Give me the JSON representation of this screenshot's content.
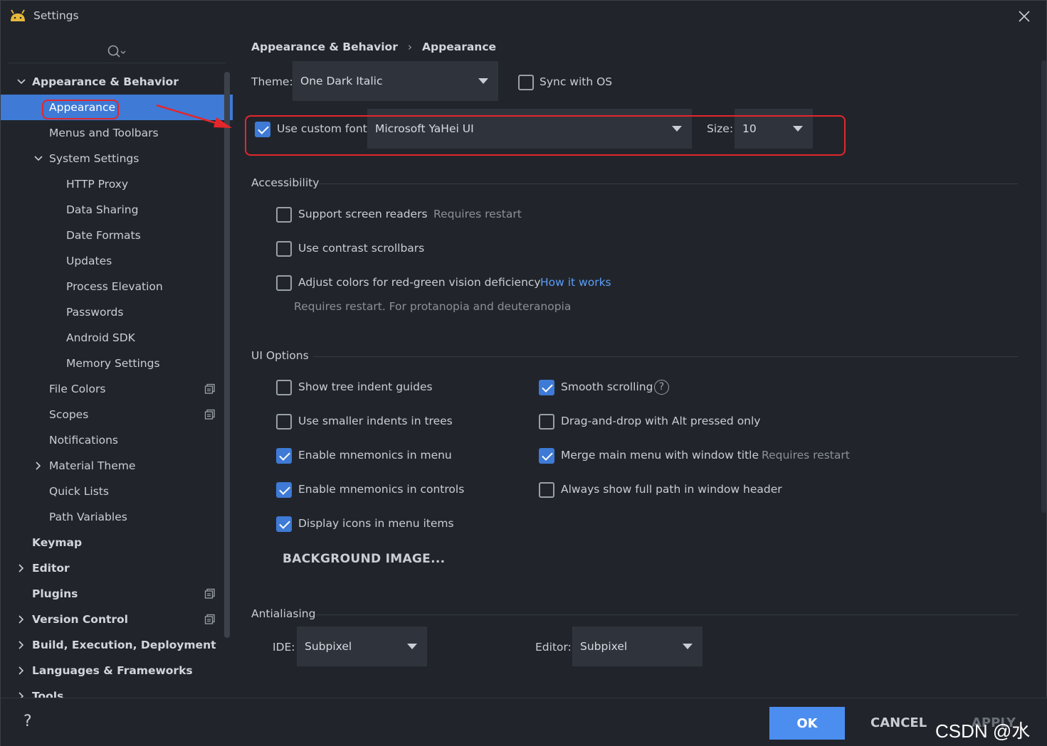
{
  "window": {
    "title": "Settings"
  },
  "colors": {
    "accent": "#3e7ad6",
    "highlight": "#e5262b",
    "link": "#5b9ef7",
    "ok_button": "#4c8ef0"
  },
  "sidebar": {
    "search_icon": "search-icon",
    "items": [
      {
        "label": "Appearance & Behavior",
        "bold": true,
        "chevron": "down"
      },
      {
        "label": "Appearance",
        "selected": true
      },
      {
        "label": "Menus and Toolbars"
      },
      {
        "label": "System Settings",
        "chevron": "down"
      },
      {
        "label": "HTTP Proxy"
      },
      {
        "label": "Data Sharing"
      },
      {
        "label": "Date Formats"
      },
      {
        "label": "Updates"
      },
      {
        "label": "Process Elevation"
      },
      {
        "label": "Passwords"
      },
      {
        "label": "Android SDK"
      },
      {
        "label": "Memory Settings"
      },
      {
        "label": "File Colors",
        "project_icon": true
      },
      {
        "label": "Scopes",
        "project_icon": true
      },
      {
        "label": "Notifications"
      },
      {
        "label": "Material Theme",
        "chevron": "right"
      },
      {
        "label": "Quick Lists"
      },
      {
        "label": "Path Variables"
      },
      {
        "label": "Keymap",
        "bold": true
      },
      {
        "label": "Editor",
        "bold": true,
        "chevron": "right"
      },
      {
        "label": "Plugins",
        "bold": true,
        "project_icon": true
      },
      {
        "label": "Version Control",
        "bold": true,
        "chevron": "right",
        "project_icon": true
      },
      {
        "label": "Build, Execution, Deployment",
        "bold": true,
        "chevron": "right"
      },
      {
        "label": "Languages & Frameworks",
        "bold": true,
        "chevron": "right"
      },
      {
        "label": "Tools",
        "bold": true,
        "chevron": "right"
      }
    ]
  },
  "breadcrumb": {
    "parent": "Appearance & Behavior",
    "separator": "›",
    "current": "Appearance"
  },
  "theme": {
    "label": "Theme:",
    "value": "One Dark Italic",
    "sync_label": "Sync with OS",
    "sync_checked": false
  },
  "custom_font": {
    "label": "Use custom font:",
    "checked": true,
    "value": "Microsoft YaHei UI",
    "size_label": "Size:",
    "size_value": "10"
  },
  "accessibility": {
    "title": "Accessibility",
    "screen_readers": {
      "label": "Support screen readers",
      "note": "Requires restart",
      "checked": false
    },
    "contrast_scrollbars": {
      "label": "Use contrast scrollbars",
      "checked": false
    },
    "red_green": {
      "label": "Adjust colors for red-green vision deficiency",
      "link": "How it works",
      "note": "Requires restart. For protanopia and deuteranopia",
      "checked": false
    }
  },
  "ui_options": {
    "title": "UI Options",
    "left": [
      {
        "label": "Show tree indent guides",
        "checked": false
      },
      {
        "label": "Use smaller indents in trees",
        "checked": false
      },
      {
        "label": "Enable mnemonics in menu",
        "checked": true
      },
      {
        "label": "Enable mnemonics in controls",
        "checked": true
      },
      {
        "label": "Display icons in menu items",
        "checked": true
      }
    ],
    "right": [
      {
        "label": "Smooth scrolling",
        "checked": true
      },
      {
        "label": "Drag-and-drop with Alt pressed only",
        "checked": false
      },
      {
        "label": "Merge main menu with window title",
        "checked": true,
        "note": "Requires restart"
      },
      {
        "label": "Always show full path in window header",
        "checked": false
      }
    ],
    "background_button": "BACKGROUND IMAGE..."
  },
  "antialiasing": {
    "title": "Antialiasing",
    "ide_label": "IDE:",
    "ide_value": "Subpixel",
    "editor_label": "Editor:",
    "editor_value": "Subpixel"
  },
  "footer": {
    "help": "?",
    "ok": "OK",
    "cancel": "CANCEL",
    "apply": "APPLY",
    "watermark": "CSDN @水kw"
  }
}
